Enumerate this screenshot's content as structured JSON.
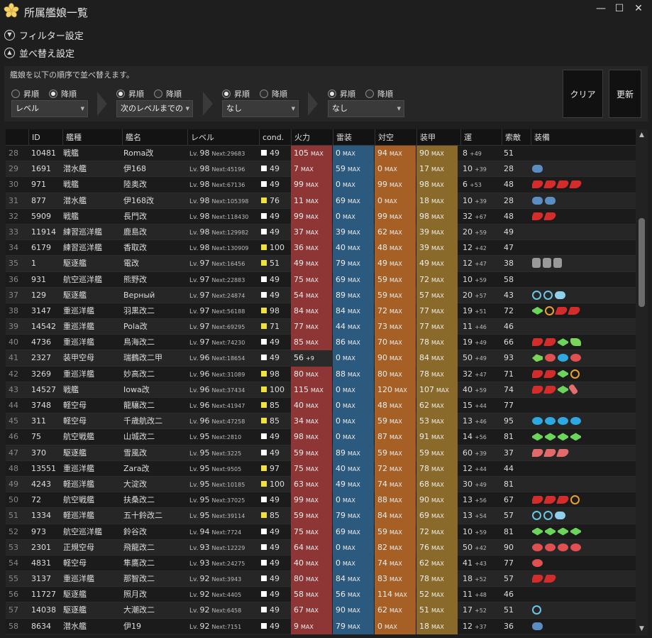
{
  "window": {
    "title": "所属艦娘一覧",
    "minimize": "—",
    "maximize": "☐",
    "close": "✕"
  },
  "sections": {
    "filter": "フィルター設定",
    "sort": "並べ替え設定"
  },
  "sort": {
    "description": "艦娘を以下の順序で並べ替えます。",
    "asc": "昇順",
    "desc": "降順",
    "keys": [
      {
        "value": "レベル",
        "order": "desc"
      },
      {
        "value": "次のレベルまでの",
        "order": "asc"
      },
      {
        "value": "なし",
        "order": "asc"
      },
      {
        "value": "なし",
        "order": "asc"
      }
    ],
    "clear": "クリア",
    "refresh": "更新"
  },
  "columns": [
    "ID",
    "艦種",
    "艦名",
    "レベル",
    "cond.",
    "火力",
    "雷装",
    "対空",
    "装甲",
    "運",
    "索敵",
    "装備"
  ],
  "level_prefix": "Lv.",
  "next_prefix": "Next:",
  "max_label": "MAX",
  "rows": [
    {
      "n": "28",
      "id": "10481",
      "type": "戦艦",
      "name": "Roma改",
      "lv": "98",
      "next": "29683",
      "cond": "49",
      "fp": "105",
      "tp": "0",
      "aa": "94",
      "ar": "90",
      "luck": "8",
      "luckp": "+49",
      "los": "51",
      "eq": []
    },
    {
      "n": "29",
      "id": "1691",
      "type": "潜水艦",
      "name": "伊168",
      "lv": "98",
      "next": "45196",
      "cond": "49",
      "fp": "7",
      "tp": "59",
      "aa": "0",
      "ar": "17",
      "luck": "10",
      "luckp": "+39",
      "los": "28",
      "eq": [
        "blue"
      ]
    },
    {
      "n": "30",
      "id": "971",
      "type": "戦艦",
      "name": "陸奥改",
      "lv": "98",
      "next": "67136",
      "cond": "49",
      "fp": "99",
      "tp": "0",
      "aa": "99",
      "ar": "98",
      "luck": "6",
      "luckp": "+53",
      "los": "48",
      "eq": [
        "red",
        "red",
        "red",
        "red"
      ]
    },
    {
      "n": "31",
      "id": "877",
      "type": "潜水艦",
      "name": "伊168改",
      "lv": "98",
      "next": "105398",
      "cond": "76",
      "fp": "11",
      "tp": "69",
      "aa": "0",
      "ar": "18",
      "luck": "10",
      "luckp": "+39",
      "los": "28",
      "eq": [
        "blue",
        "blue"
      ]
    },
    {
      "n": "32",
      "id": "5909",
      "type": "戦艦",
      "name": "長門改",
      "lv": "98",
      "next": "118430",
      "cond": "49",
      "fp": "99",
      "tp": "0",
      "aa": "99",
      "ar": "98",
      "luck": "32",
      "luckp": "+67",
      "los": "48",
      "eq": [
        "red",
        "red"
      ]
    },
    {
      "n": "33",
      "id": "11914",
      "type": "練習巡洋艦",
      "name": "鹿島改",
      "lv": "98",
      "next": "129982",
      "cond": "49",
      "fp": "37",
      "tp": "39",
      "aa": "62",
      "ar": "39",
      "luck": "20",
      "luckp": "+59",
      "los": "49",
      "eq": []
    },
    {
      "n": "34",
      "id": "6179",
      "type": "練習巡洋艦",
      "name": "香取改",
      "lv": "98",
      "next": "130909",
      "cond": "100",
      "fp": "36",
      "tp": "40",
      "aa": "48",
      "ar": "39",
      "luck": "12",
      "luckp": "+42",
      "los": "47",
      "eq": []
    },
    {
      "n": "35",
      "id": "1",
      "type": "駆逐艦",
      "name": "電改",
      "lv": "97",
      "next": "16456",
      "cond": "51",
      "fp": "49",
      "tp": "79",
      "aa": "49",
      "ar": "49",
      "luck": "12",
      "luckp": "+47",
      "los": "38",
      "eq": [
        "drum",
        "drum",
        "drum"
      ]
    },
    {
      "n": "36",
      "id": "931",
      "type": "航空巡洋艦",
      "name": "熊野改",
      "lv": "97",
      "next": "22883",
      "cond": "49",
      "fp": "75",
      "tp": "69",
      "aa": "59",
      "ar": "72",
      "luck": "10",
      "luckp": "+59",
      "los": "58",
      "eq": []
    },
    {
      "n": "37",
      "id": "129",
      "type": "駆逐艦",
      "name": "Верный",
      "lv": "97",
      "next": "24874",
      "cond": "49",
      "fp": "54",
      "tp": "89",
      "aa": "59",
      "ar": "57",
      "luck": "20",
      "luckp": "+57",
      "los": "43",
      "eq": [
        "radar",
        "radar",
        "sonar"
      ]
    },
    {
      "n": "38",
      "id": "3147",
      "type": "重巡洋艦",
      "name": "羽黒改二",
      "lv": "97",
      "next": "56188",
      "cond": "98",
      "fp": "84",
      "tp": "84",
      "aa": "72",
      "ar": "77",
      "luck": "19",
      "luckp": "+51",
      "los": "72",
      "eq": [
        "plane",
        "orad",
        "red",
        "red"
      ]
    },
    {
      "n": "39",
      "id": "14542",
      "type": "重巡洋艦",
      "name": "Pola改",
      "lv": "97",
      "next": "69295",
      "cond": "71",
      "fp": "77",
      "tp": "44",
      "aa": "73",
      "ar": "77",
      "luck": "11",
      "luckp": "+46",
      "los": "46",
      "eq": []
    },
    {
      "n": "40",
      "id": "4736",
      "type": "重巡洋艦",
      "name": "鳥海改二",
      "lv": "97",
      "next": "74230",
      "cond": "49",
      "fp": "85",
      "tp": "86",
      "aa": "70",
      "ar": "78",
      "luck": "19",
      "luckp": "+49",
      "los": "66",
      "eq": [
        "red",
        "red",
        "plane",
        "green"
      ]
    },
    {
      "n": "41",
      "id": "2327",
      "type": "装甲空母",
      "name": "瑞鶴改二甲",
      "lv": "96",
      "next": "18654",
      "cond": "49",
      "fp": "56",
      "fpplus": "+9",
      "tp": "0",
      "aa": "90",
      "ar": "84",
      "luck": "50",
      "luckp": "+49",
      "los": "93",
      "eq": [
        "fighter",
        "torp",
        "bomber",
        "torp"
      ]
    },
    {
      "n": "42",
      "id": "3269",
      "type": "重巡洋艦",
      "name": "妙高改二",
      "lv": "96",
      "next": "31089",
      "cond": "98",
      "fp": "80",
      "tp": "88",
      "aa": "80",
      "ar": "78",
      "luck": "32",
      "luckp": "+47",
      "los": "71",
      "eq": [
        "red",
        "red",
        "plane",
        "orad"
      ]
    },
    {
      "n": "43",
      "id": "14527",
      "type": "戦艦",
      "name": "Iowa改",
      "lv": "96",
      "next": "37434",
      "cond": "100",
      "fp": "115",
      "tp": "0",
      "aa": "120",
      "ar": "107",
      "luck": "40",
      "luckp": "+59",
      "los": "74",
      "eq": [
        "red",
        "red",
        "plane",
        "flare"
      ]
    },
    {
      "n": "44",
      "id": "3748",
      "type": "軽空母",
      "name": "龍驤改二",
      "lv": "96",
      "next": "41947",
      "cond": "85",
      "fp": "40",
      "tp": "0",
      "aa": "48",
      "ar": "62",
      "luck": "15",
      "luckp": "+44",
      "los": "77",
      "eq": []
    },
    {
      "n": "45",
      "id": "311",
      "type": "軽空母",
      "name": "千歳航改二",
      "lv": "96",
      "next": "47258",
      "cond": "85",
      "fp": "34",
      "tp": "0",
      "aa": "59",
      "ar": "53",
      "luck": "13",
      "luckp": "+46",
      "los": "95",
      "eq": [
        "bomber",
        "bomber",
        "bomber",
        "bomber"
      ]
    },
    {
      "n": "46",
      "id": "75",
      "type": "航空戦艦",
      "name": "山城改二",
      "lv": "95",
      "next": "2810",
      "cond": "49",
      "fp": "98",
      "tp": "0",
      "aa": "87",
      "ar": "91",
      "luck": "14",
      "luckp": "+56",
      "los": "81",
      "eq": [
        "plane",
        "plane",
        "plane",
        "plane"
      ]
    },
    {
      "n": "47",
      "id": "370",
      "type": "駆逐艦",
      "name": "雪風改",
      "lv": "95",
      "next": "3225",
      "cond": "49",
      "fp": "59",
      "tp": "89",
      "aa": "59",
      "ar": "59",
      "luck": "60",
      "luckp": "+39",
      "los": "37",
      "eq": [
        "pink",
        "pink",
        "pink"
      ]
    },
    {
      "n": "48",
      "id": "13551",
      "type": "重巡洋艦",
      "name": "Zara改",
      "lv": "95",
      "next": "9505",
      "cond": "97",
      "fp": "75",
      "tp": "40",
      "aa": "72",
      "ar": "78",
      "luck": "12",
      "luckp": "+44",
      "los": "44",
      "eq": []
    },
    {
      "n": "49",
      "id": "4243",
      "type": "軽巡洋艦",
      "name": "大淀改",
      "lv": "95",
      "next": "10185",
      "cond": "100",
      "fp": "63",
      "tp": "49",
      "aa": "74",
      "ar": "68",
      "luck": "30",
      "luckp": "+49",
      "los": "81",
      "eq": []
    },
    {
      "n": "50",
      "id": "72",
      "type": "航空戦艦",
      "name": "扶桑改二",
      "lv": "95",
      "next": "37025",
      "cond": "49",
      "fp": "99",
      "tp": "0",
      "aa": "88",
      "ar": "90",
      "luck": "13",
      "luckp": "+56",
      "los": "67",
      "eq": [
        "red",
        "red",
        "red",
        "orad"
      ]
    },
    {
      "n": "51",
      "id": "1334",
      "type": "軽巡洋艦",
      "name": "五十鈴改二",
      "lv": "95",
      "next": "39114",
      "cond": "85",
      "fp": "59",
      "tp": "79",
      "aa": "84",
      "ar": "69",
      "luck": "13",
      "luckp": "+54",
      "los": "57",
      "eq": [
        "radar",
        "radar",
        "sonar"
      ]
    },
    {
      "n": "52",
      "id": "973",
      "type": "航空巡洋艦",
      "name": "鈴谷改",
      "lv": "94",
      "next": "7724",
      "cond": "49",
      "fp": "75",
      "tp": "69",
      "aa": "59",
      "ar": "72",
      "luck": "10",
      "luckp": "+59",
      "los": "81",
      "eq": [
        "plane",
        "plane",
        "plane",
        "plane"
      ]
    },
    {
      "n": "53",
      "id": "2301",
      "type": "正規空母",
      "name": "飛龍改二",
      "lv": "93",
      "next": "12229",
      "cond": "49",
      "fp": "64",
      "tp": "0",
      "aa": "82",
      "ar": "76",
      "luck": "50",
      "luckp": "+42",
      "los": "90",
      "eq": [
        "torp",
        "torp",
        "torp",
        "torp"
      ]
    },
    {
      "n": "54",
      "id": "4831",
      "type": "軽空母",
      "name": "隼鷹改二",
      "lv": "93",
      "next": "24275",
      "cond": "49",
      "fp": "40",
      "tp": "0",
      "aa": "74",
      "ar": "62",
      "luck": "41",
      "luckp": "+43",
      "los": "77",
      "eq": [
        "torp"
      ]
    },
    {
      "n": "55",
      "id": "3137",
      "type": "重巡洋艦",
      "name": "那智改二",
      "lv": "92",
      "next": "3943",
      "cond": "49",
      "fp": "80",
      "tp": "84",
      "aa": "83",
      "ar": "78",
      "luck": "18",
      "luckp": "+52",
      "los": "57",
      "eq": [
        "red",
        "red"
      ]
    },
    {
      "n": "56",
      "id": "11727",
      "type": "駆逐艦",
      "name": "照月改",
      "lv": "92",
      "next": "4405",
      "cond": "49",
      "fp": "58",
      "tp": "56",
      "aa": "114",
      "ar": "52",
      "luck": "11",
      "luckp": "+48",
      "los": "46",
      "eq": []
    },
    {
      "n": "57",
      "id": "14038",
      "type": "駆逐艦",
      "name": "大潮改二",
      "lv": "92",
      "next": "6458",
      "cond": "49",
      "fp": "67",
      "tp": "90",
      "aa": "62",
      "ar": "51",
      "luck": "17",
      "luckp": "+52",
      "los": "51",
      "eq": [
        "radar"
      ]
    },
    {
      "n": "58",
      "id": "8634",
      "type": "潜水艦",
      "name": "伊19",
      "lv": "92",
      "next": "7151",
      "cond": "49",
      "fp": "9",
      "tp": "79",
      "aa": "0",
      "ar": "18",
      "luck": "12",
      "luckp": "+37",
      "los": "36",
      "eq": [
        "blue"
      ]
    }
  ],
  "colors": {
    "cond_white": "#ffffff",
    "cond_yellow": "#f0e040",
    "firepower": "#8e3535",
    "torpedo": "#2b5a7e",
    "antiair": "#a65f25",
    "armor": "#8a6a2a"
  }
}
